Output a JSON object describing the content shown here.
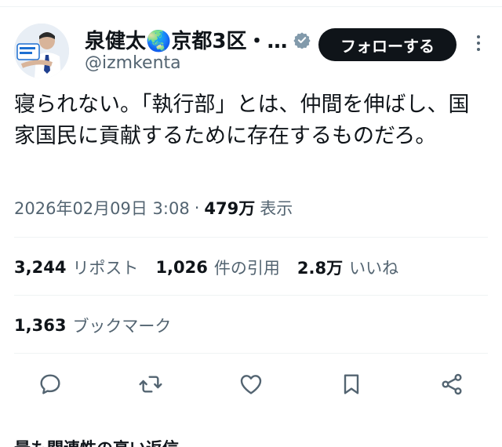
{
  "profile": {
    "display_name": "泉健太🌏京都3区・…",
    "handle": "@izmkenta",
    "follow_label": "フォローする"
  },
  "tweet": {
    "text": "寝られない。「執行部」とは、仲間を伸ばし、国家国民に貢献するために存在するものだろ。",
    "datetime": "2026年02月09日 3:08",
    "separator": "·",
    "views": "479万",
    "views_label": "表示"
  },
  "stats": {
    "retweets": "3,244",
    "retweets_label": "リポスト",
    "quotes": "1,026",
    "quotes_label": "件の引用",
    "likes": "2.8万",
    "likes_label": "いいね",
    "bookmarks": "1,363",
    "bookmarks_label": "ブックマーク"
  },
  "replies_sort_label": "最も関連性の高い返信 ⌄",
  "colors": {
    "text": "#0f1419",
    "secondary": "#536471",
    "verified": "#829aab",
    "divider": "#eff3f4"
  },
  "icons": [
    "verified-badge-icon",
    "more-icon",
    "reply-icon",
    "retweet-icon",
    "like-icon",
    "bookmark-icon",
    "share-icon"
  ]
}
